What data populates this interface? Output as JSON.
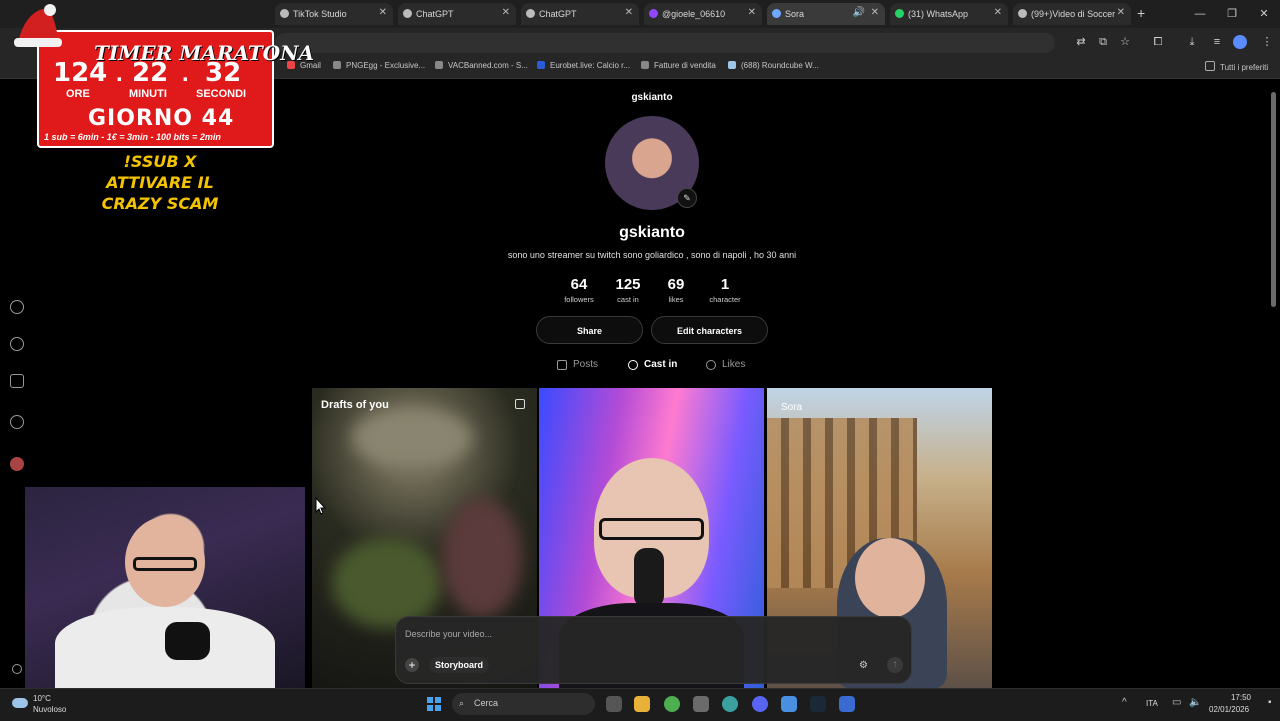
{
  "browser": {
    "tabs": [
      {
        "label": "TikTok Studio",
        "active": false
      },
      {
        "label": "ChatGPT",
        "active": false
      },
      {
        "label": "ChatGPT",
        "active": false
      },
      {
        "label": "@gioele_06610",
        "active": false
      },
      {
        "label": "Sora",
        "active": true
      },
      {
        "label": "(31) WhatsApp",
        "active": false
      },
      {
        "label": "(99+)Video di Soccer",
        "active": false
      }
    ],
    "bookmarks": [
      "Gmail",
      "PNGEgg - Exclusive...",
      "VACBanned.com - S...",
      "Eurobet.live: Calcio r...",
      "Fatture di vendita",
      "(688) Roundcube W..."
    ],
    "bookmarks_right": "Tutti i preferiti"
  },
  "overlay": {
    "title": "TIMER MARATONA",
    "hours": "124",
    "minutes": "22",
    "seconds": "32",
    "hours_label": "ORE",
    "minutes_label": "MINUTI",
    "seconds_label": "SECONDI",
    "day": "GIORNO 44",
    "rates": "1 sub = 6min - 1€ = 3min - 100 bits = 2min",
    "scam_line1": "!SSUB X",
    "scam_line2": "ATTIVARE IL",
    "scam_line3": "CRAZY SCAM"
  },
  "profile": {
    "handle": "gskianto",
    "name": "gskianto",
    "bio": "sono uno streamer su twitch sono goliardico , sono di napoli , ho 30 anni",
    "stats": [
      {
        "value": "64",
        "label": "followers"
      },
      {
        "value": "125",
        "label": "cast in"
      },
      {
        "value": "69",
        "label": "likes"
      },
      {
        "value": "1",
        "label": "character"
      }
    ],
    "share_label": "Share",
    "edit_label": "Edit characters",
    "tabs": [
      {
        "label": "Posts",
        "active": false
      },
      {
        "label": "Cast in",
        "active": true
      },
      {
        "label": "Likes",
        "active": false
      }
    ]
  },
  "grid": {
    "drafts_label": "Drafts of you",
    "rome_watermark": "Sora"
  },
  "composer": {
    "placeholder": "Describe your video...",
    "storyboard_label": "Storyboard"
  },
  "taskbar": {
    "temp": "10°C",
    "weather": "Nuvoloso",
    "search": "Cerca",
    "lang": "ITA",
    "time": "17:50",
    "date": "02/01/2026"
  }
}
